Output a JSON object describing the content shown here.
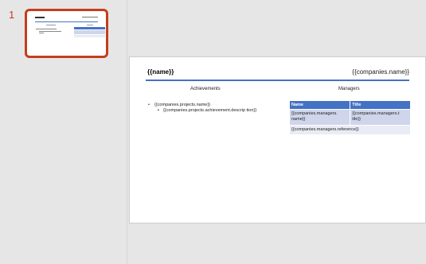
{
  "thumbnails": [
    {
      "number": "1",
      "selected": true
    }
  ],
  "slide": {
    "title": "{{name}}",
    "company": "{{companies.name}}",
    "achievements_header": "Achievements",
    "managers_header": "Managers",
    "bullets": [
      {
        "level": 1,
        "text": "{{companies.projects.name}}"
      },
      {
        "level": 2,
        "text": "{{companies.projects.achievement.descrip tion}}"
      }
    ],
    "table": {
      "headers": [
        "Name",
        "Title"
      ],
      "row1": [
        "{{companies.managers. name}}",
        "{{companies.managers.t itle}}"
      ],
      "row2": [
        "{{companies.managers.reference}}"
      ]
    }
  },
  "colors": {
    "accent": "#4472c4",
    "selection": "#c43e1c",
    "row_light": "#cfd5ea",
    "row_lighter": "#e9ebf5"
  }
}
